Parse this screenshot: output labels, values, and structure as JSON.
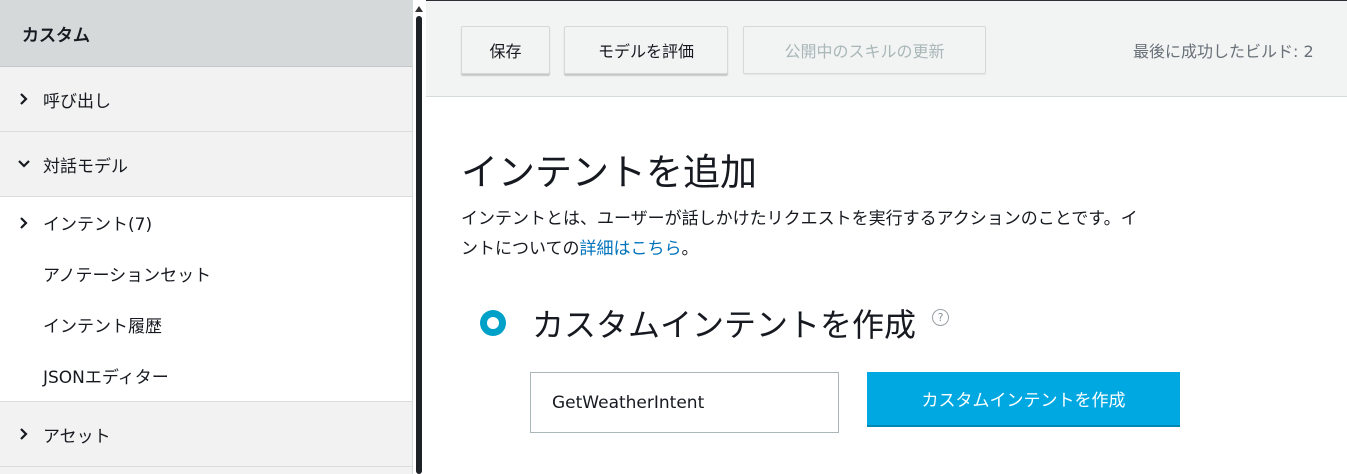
{
  "sidebar": {
    "header": "カスタム",
    "invocation": "呼び出し",
    "interaction_model": "対話モデル",
    "sub_items": {
      "intents": "インテント(7)",
      "annotation_sets": "アノテーションセット",
      "intent_history": "インテント履歴",
      "json_editor": "JSONエディター"
    },
    "assets": "アセット"
  },
  "toolbar": {
    "save_label": "保存",
    "evaluate_label": "モデルを評価",
    "update_label": "公開中のスキルの更新",
    "last_build": "最後に成功したビルド: 2"
  },
  "main": {
    "title": "インテントを追加",
    "desc_line1": "インテントとは、ユーザーが話しかけたリクエストを実行するアクションのことです。イ",
    "desc_line2_pre": "ントについての",
    "desc_link": "詳細はこちら",
    "desc_line2_post": "。",
    "custom_option_label": "カスタムインテントを作成",
    "help_glyph": "?",
    "intent_input_value": "GetWeatherIntent",
    "create_button_label": "カスタムインテントを作成"
  },
  "colors": {
    "accent": "#00a8e1",
    "link": "#0073bb",
    "radio": "#00a1c9"
  }
}
